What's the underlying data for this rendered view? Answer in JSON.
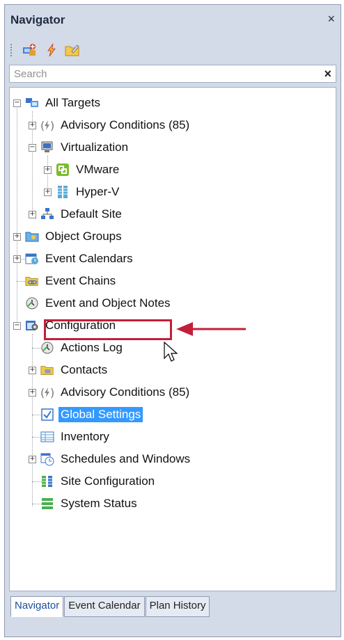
{
  "panel": {
    "title": "Navigator",
    "close_glyph": "×"
  },
  "toolbar": {
    "buttons": [
      "add-target-icon",
      "lightning-icon",
      "folder-edit-icon"
    ]
  },
  "search": {
    "placeholder": "Search",
    "value": "",
    "clear_glyph": "×"
  },
  "tree": {
    "items": [
      {
        "label": "All Targets",
        "icon": "targets-icon",
        "expander": "−"
      },
      {
        "label": "Advisory Conditions (85)",
        "icon": "advisory-icon",
        "expander": "+"
      },
      {
        "label": "Virtualization",
        "icon": "monitor-icon",
        "expander": "−"
      },
      {
        "label": "VMware",
        "icon": "vmware-icon",
        "expander": "+"
      },
      {
        "label": "Hyper-V",
        "icon": "hyperv-icon",
        "expander": "+"
      },
      {
        "label": "Default Site",
        "icon": "site-icon",
        "expander": "+"
      },
      {
        "label": "Object Groups",
        "icon": "object-groups-icon",
        "expander": "+"
      },
      {
        "label": "Event Calendars",
        "icon": "event-calendars-icon",
        "expander": "+"
      },
      {
        "label": "Event Chains",
        "icon": "event-chains-icon",
        "expander": ""
      },
      {
        "label": "Event and Object Notes",
        "icon": "notes-icon",
        "expander": ""
      },
      {
        "label": "Configuration",
        "icon": "configuration-icon",
        "expander": "−"
      },
      {
        "label": "Actions Log",
        "icon": "actions-log-icon",
        "expander": ""
      },
      {
        "label": "Contacts",
        "icon": "contacts-icon",
        "expander": "+"
      },
      {
        "label": "Advisory Conditions (85)",
        "icon": "advisory-icon",
        "expander": "+"
      },
      {
        "label": "Global Settings",
        "icon": "checkbox-icon",
        "expander": ""
      },
      {
        "label": "Inventory",
        "icon": "inventory-icon",
        "expander": ""
      },
      {
        "label": "Schedules and Windows",
        "icon": "schedules-icon",
        "expander": "+"
      },
      {
        "label": "Site Configuration",
        "icon": "site-config-icon",
        "expander": ""
      },
      {
        "label": "System Status",
        "icon": "system-status-icon",
        "expander": ""
      }
    ]
  },
  "tabs": [
    {
      "label": "Navigator",
      "active": true
    },
    {
      "label": "Event Calendar",
      "active": false
    },
    {
      "label": "Plan History",
      "active": false
    }
  ],
  "colors": {
    "selection": "#3399ff",
    "highlight_box": "#c21f3a",
    "arrow": "#c21f3a"
  }
}
